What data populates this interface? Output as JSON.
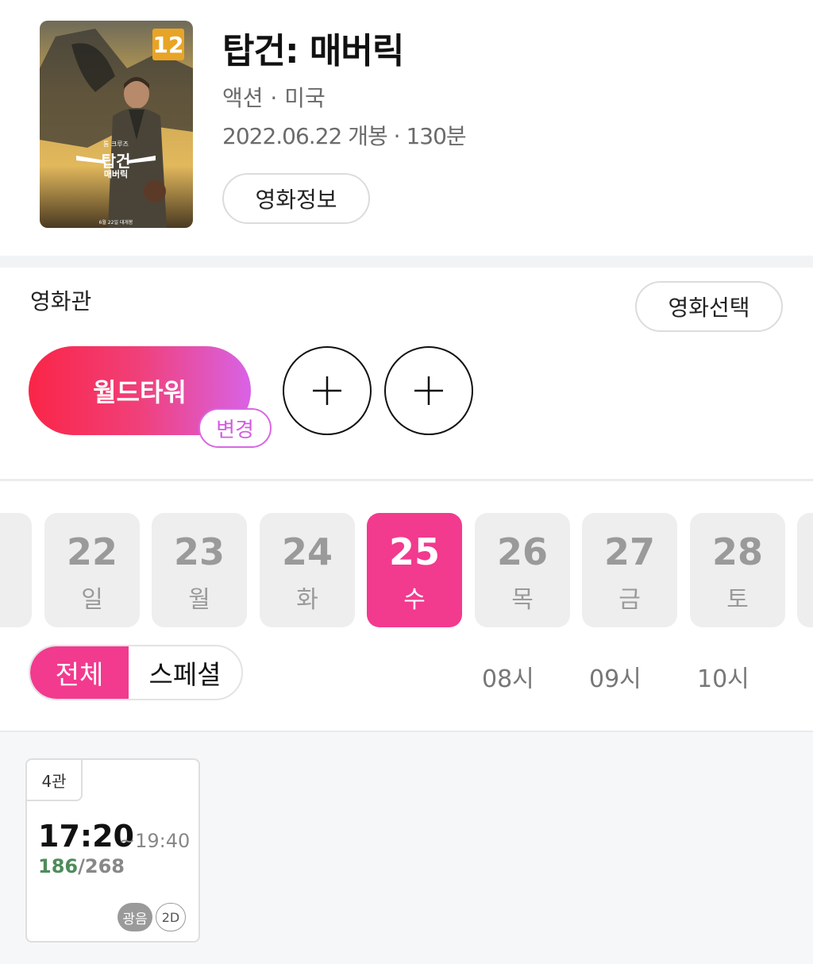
{
  "movie": {
    "title": "탑건: 매버릭",
    "genre_country": "액션 · 미국",
    "release_runtime": "2022.06.22 개봉 · 130분",
    "info_button": "영화정보",
    "rating": "12",
    "poster_title": "탑건",
    "poster_subtitle": "매버릭",
    "poster_actor": "톰 크루즈",
    "poster_release_note": "6월 22일 대개봉"
  },
  "theater_section": {
    "label": "영화관",
    "select_movie_button": "영화선택",
    "selected_theater": "월드타워",
    "change_label": "변경"
  },
  "dates": [
    {
      "day": "22",
      "weekday": "일",
      "selected": false
    },
    {
      "day": "23",
      "weekday": "월",
      "selected": false
    },
    {
      "day": "24",
      "weekday": "화",
      "selected": false
    },
    {
      "day": "25",
      "weekday": "수",
      "selected": true
    },
    {
      "day": "26",
      "weekday": "목",
      "selected": false
    },
    {
      "day": "27",
      "weekday": "금",
      "selected": false
    },
    {
      "day": "28",
      "weekday": "토",
      "selected": false
    }
  ],
  "filters": {
    "tabs": [
      "전체",
      "스페셜"
    ],
    "active_tab": "전체",
    "hours": [
      "08시",
      "09시",
      "10시"
    ]
  },
  "showtimes": [
    {
      "hall": "4관",
      "start": "17:20",
      "end": "~19:40",
      "seats_available": "186",
      "seats_total": "/268",
      "badges": [
        "광음",
        "2D"
      ]
    }
  ],
  "colors": {
    "accent_pink": "#f23a8f",
    "gradient_start": "#fa2547",
    "gradient_end": "#d863e6",
    "available_green": "#4d8c5b"
  }
}
